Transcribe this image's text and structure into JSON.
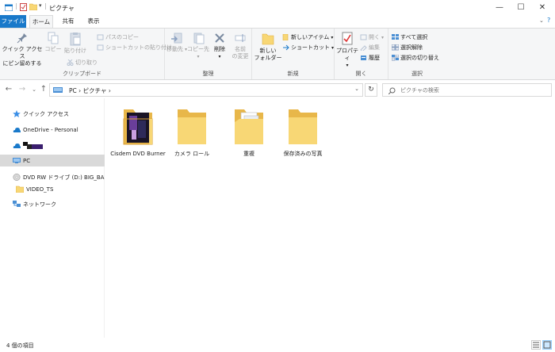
{
  "window": {
    "title": "ピクチャ",
    "controls": {
      "minimize": "—",
      "maximize": "☐",
      "close": "✕"
    }
  },
  "ribbon_tabs": [
    "ファイル",
    "ホーム",
    "共有",
    "表示"
  ],
  "ribbon": {
    "clipboard": {
      "pin_line1": "クイック アクセス",
      "pin_line2": "にピン留めする",
      "copy": "コピー",
      "paste": "貼り付け",
      "copy_path": "パスのコピー",
      "paste_shortcut": "ショートカットの貼り付け",
      "cut": "切り取り",
      "label": "クリップボード"
    },
    "organize": {
      "move_to": "移動先",
      "copy_to": "コピー先",
      "delete": "削除",
      "rename_line1": "名前",
      "rename_line2": "の変更",
      "label": "整理"
    },
    "new": {
      "new_folder_line1": "新しい",
      "new_folder_line2": "フォルダー",
      "new_item": "新しいアイテム",
      "easy_access": "ショートカット",
      "label": "新規"
    },
    "open": {
      "properties": "プロパティ",
      "open": "開く",
      "edit": "編集",
      "history": "履歴",
      "label": "開く"
    },
    "select": {
      "select_all": "すべて選択",
      "select_none": "選択解除",
      "invert": "選択の切り替え",
      "label": "選択"
    }
  },
  "address": {
    "crumbs": "PC  ›  ピクチャ  ›",
    "search_placeholder": "ピクチャの検索"
  },
  "nav_pane": [
    {
      "label": "クイック アクセス",
      "icon": "star-icon"
    },
    {
      "label": "OneDrive - Personal",
      "icon": "cloud-icon"
    },
    {
      "label": "",
      "icon": "cloud-icon"
    },
    {
      "label": "PC",
      "icon": "pc-icon",
      "selected": true
    },
    {
      "label": "DVD RW ドライブ (D:) BIG_BANG_",
      "icon": "dvd-drive-icon"
    },
    {
      "label": "VIDEO_TS",
      "icon": "folder-icon"
    },
    {
      "label": "ネットワーク",
      "icon": "network-icon"
    }
  ],
  "files": [
    {
      "name": "Cisdem DVD Burner",
      "kind": "folder-with-image"
    },
    {
      "name": "カメラ ロール",
      "kind": "folder"
    },
    {
      "name": "重複",
      "kind": "folder-with-docs"
    },
    {
      "name": "保存済みの写真",
      "kind": "folder"
    }
  ],
  "status": {
    "count": "4 個の項目"
  },
  "colors": {
    "accent": "#1979ca",
    "folder": "#f8d775",
    "folder_dark": "#e8b74a",
    "selected": "#d9d9d9"
  }
}
